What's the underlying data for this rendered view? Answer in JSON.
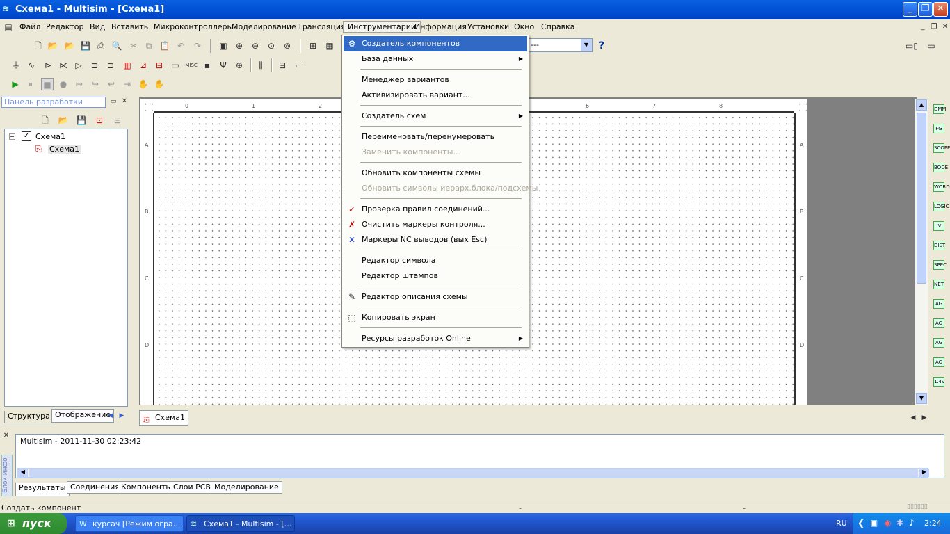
{
  "window": {
    "title": "Схема1 - Multisim - [Схема1]"
  },
  "menu": [
    "Файл",
    "Редактор",
    "Вид",
    "Вставить",
    "Микроконтроллеры",
    "Моделирование",
    "Трансляция",
    "Инструментарий",
    "Информация",
    "Установки",
    "Окно",
    "Справка"
  ],
  "tools_menu": {
    "items": [
      {
        "label": "Создатель компонентов",
        "icon": "component-wizard-icon",
        "state": "highlighted"
      },
      {
        "label": "База данных",
        "submenu": true
      },
      {
        "sep": true
      },
      {
        "label": "Менеджер вариантов"
      },
      {
        "label": "Активизировать вариант..."
      },
      {
        "sep": true
      },
      {
        "label": "Создатель схем",
        "submenu": true
      },
      {
        "sep": true
      },
      {
        "label": "Переименовать/перенумеровать"
      },
      {
        "label": "Заменить компоненты...",
        "state": "disabled"
      },
      {
        "sep": true
      },
      {
        "label": "Обновить компоненты схемы"
      },
      {
        "label": "Обновить символы иерарх.блока/подсхемы",
        "state": "disabled"
      },
      {
        "sep": true
      },
      {
        "label": "Проверка правил соединений...",
        "icon": "erc-check-icon"
      },
      {
        "label": "Очистить маркеры контроля...",
        "icon": "clear-markers-icon"
      },
      {
        "label": "Маркеры NC выводов (вых Esc)",
        "icon": "nc-marker-icon"
      },
      {
        "sep": true
      },
      {
        "label": "Редактор символа"
      },
      {
        "label": "Редактор штампов"
      },
      {
        "sep": true
      },
      {
        "label": "Редактор описания схемы",
        "icon": "description-editor-icon"
      },
      {
        "sep": true
      },
      {
        "label": "Копировать экран",
        "icon": "capture-screen-icon"
      },
      {
        "sep": true
      },
      {
        "label": "Ресурсы разработок Online",
        "submenu": true
      }
    ]
  },
  "design_panel": {
    "title": "Панель разработки",
    "tree_root": "Схема1",
    "tree_child": "Схема1",
    "tabs": [
      "Структура",
      "Отображение"
    ]
  },
  "sheet": {
    "ruler_top": [
      "0",
      "1",
      "2",
      "6",
      "7",
      "8"
    ],
    "ruler_side": [
      "A",
      "B",
      "C",
      "D"
    ]
  },
  "doc_tab": "Схема1",
  "log": {
    "side_label": "Блок инфо",
    "entry": "Multisim  -  2011-11-30 02:23:42",
    "tabs": [
      "Результаты",
      "Соединения",
      "Компоненты",
      "Слои PCB",
      "Моделирование"
    ]
  },
  "status": {
    "text": "Создать компонент",
    "f1": "-",
    "f2": "-"
  },
  "taskbar": {
    "start": "пуск",
    "tasks": [
      "курсач [Режим огра...",
      "Схема1 - Multisim - [..."
    ],
    "lang": "RU",
    "clock": "2:24"
  },
  "right_instruments": [
    "DMM",
    "FG",
    "SCOPE",
    "BODE",
    "WORD",
    "LOGIC",
    "IV",
    "DIST",
    "SPEC",
    "NET",
    "AG",
    "AG",
    "AG",
    "AG",
    "1.4v"
  ],
  "colors": {
    "highlight": "#316ac5",
    "titlebar": "#0355d8",
    "taskbar": "#245edb",
    "start": "#3c9a3c"
  }
}
